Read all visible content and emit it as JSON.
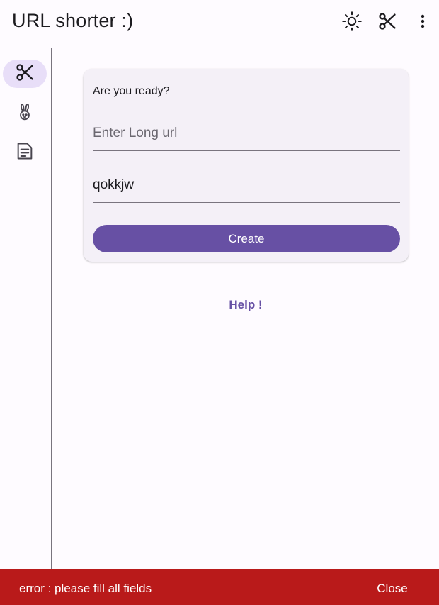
{
  "appbar": {
    "title": "URL shorter :)",
    "actions": [
      {
        "icon": "sun-icon",
        "name": "theme-toggle"
      },
      {
        "icon": "scissors-icon",
        "name": "shorten"
      },
      {
        "icon": "more-vert-icon",
        "name": "more-menu"
      }
    ]
  },
  "rail": {
    "items": [
      {
        "icon": "scissors-icon",
        "active": true
      },
      {
        "icon": "rabbit-icon",
        "active": false
      },
      {
        "icon": "document-icon",
        "active": false
      }
    ]
  },
  "form": {
    "heading": "Are you ready?",
    "long_url": {
      "value": "",
      "placeholder": "Enter Long url"
    },
    "alias": {
      "value": "qokkjw",
      "placeholder": ""
    },
    "create_label": "Create"
  },
  "help_label": "Help !",
  "snackbar": {
    "message": "error : please fill all fields",
    "action_label": "Close"
  },
  "colors": {
    "primary": "#6750a4",
    "rail_active": "#e8def8",
    "card_bg": "#f4f0f7",
    "background": "#fefbff",
    "error": "#b91a1a"
  }
}
